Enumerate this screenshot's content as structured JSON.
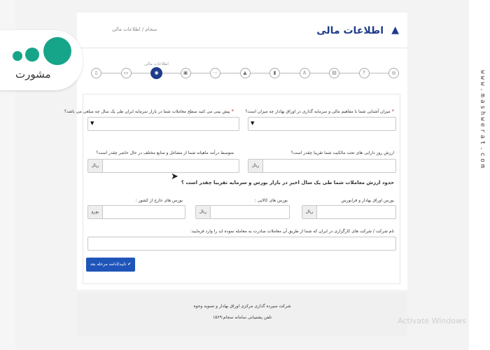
{
  "watermark_url": "www.mashwerat.com",
  "logo": {
    "text": "مشورت"
  },
  "header": {
    "title": "اطلاعات مالی",
    "breadcrumb": "سجام / اطلاعات مالی",
    "title_icon": "building-icon"
  },
  "stepper": {
    "active_label": "اطلاعات مالی",
    "steps": [
      {
        "icon": "document-icon",
        "symbol": "▯"
      },
      {
        "icon": "card-icon",
        "symbol": "▭"
      },
      {
        "icon": "finance-icon",
        "symbol": "◉"
      },
      {
        "icon": "briefcase-icon",
        "symbol": "▣"
      },
      {
        "icon": "dots-icon",
        "symbol": "⋯"
      },
      {
        "icon": "graduation-icon",
        "symbol": "▲"
      },
      {
        "icon": "bookmark-icon",
        "symbol": "▮"
      },
      {
        "icon": "person-icon",
        "symbol": "♙"
      },
      {
        "icon": "id-card-icon",
        "symbol": "▤"
      },
      {
        "icon": "question-icon",
        "symbol": "?"
      },
      {
        "icon": "badge-icon",
        "symbol": "◎"
      }
    ]
  },
  "form": {
    "q1_label": "میزان آشنایی شما با مفاهیم مالی و سرمایه گذاری در اوراق بهادار چه میزان است؟",
    "q2_label": "پیش بینی می کنید سطح معاملات شما در بازار سرمایه ایران طی یک سال چه مبلغی می باشد؟",
    "q3_label": "ارزش روز دارایی های تحت مالکیت شما تقریبا چقدر است؟",
    "q4_label": "متوسط درآمد ماهیانه شما از مشاغل و منابع مختلف در حال حاضر چقدر است؟",
    "section_label": "حدود ارزش معاملات شما طی یک سال اخیر در بازار بورس و سرمایه تقریبا چقدر است ؟",
    "s1_label": "بورس اوراق بهادار و فرابورس",
    "s2_label": "بورس های کالایی :",
    "s3_label": "بورس های خارج از کشور :",
    "broker_label": "نام شرکت / شرکت های کارگزاری در ایران که شما از طریق آن معاملات صادرت به معامله نموده اید را وارد فرمایید:",
    "currency_rial": "ریال",
    "currency_euro": "یورو",
    "submit_label": "تایید/ادامه مرحله بعد",
    "submit_icon": "check-icon"
  },
  "footer": {
    "line1": "شرکت سپرده گذاری مرکزی اوراق بهادار و تسویه وجوه",
    "line2": "تلفن پشتیبانی سامانه سجام:۱۵۶۹"
  },
  "windows_notice": "Activate Windows",
  "colors": {
    "primary": "#1f3c8a",
    "button": "#1f55b8",
    "logo": "#17a589",
    "required": "#dd2222"
  }
}
